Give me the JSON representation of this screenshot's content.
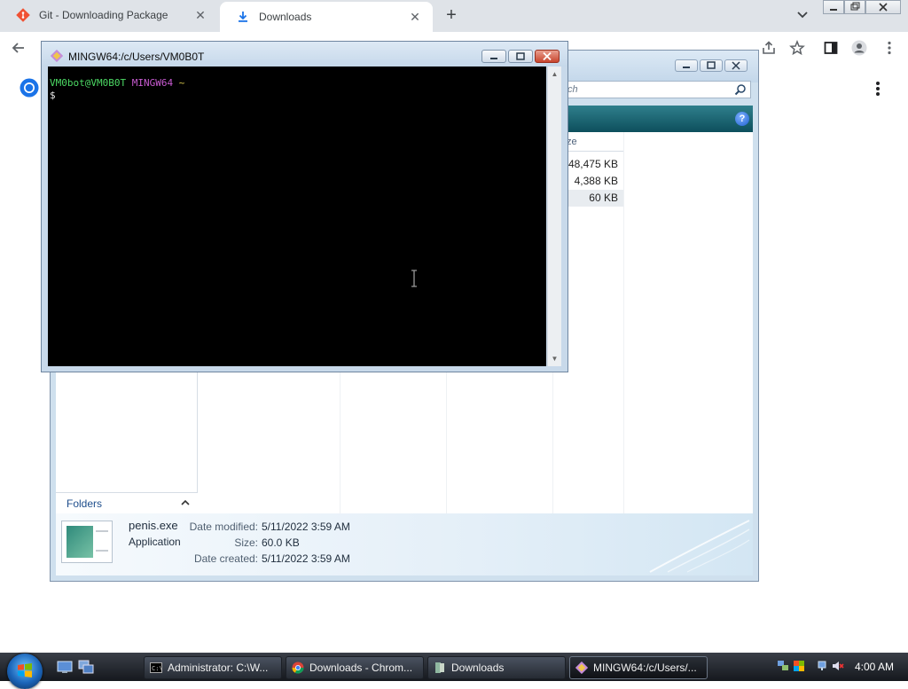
{
  "browser": {
    "tabs": [
      {
        "title": "Git - Downloading Package",
        "icon": "git-icon",
        "active": false
      },
      {
        "title": "Downloads",
        "icon": "download-icon",
        "active": true
      }
    ],
    "new_tab_label": "+",
    "close_glyph": "✕"
  },
  "explorer": {
    "search_placeholder": "ch",
    "size_column_header": "ze",
    "sizes": [
      "48,475 KB",
      "4,388 KB",
      "60 KB"
    ],
    "folders_label": "Folders",
    "help_glyph": "?",
    "details": {
      "file_name": "penis.exe",
      "file_type": "Application",
      "date_modified_label": "Date modified:",
      "date_modified": "5/11/2022 3:59 AM",
      "size_label": "Size:",
      "size": "60.0 KB",
      "date_created_label": "Date created:",
      "date_created": "5/11/2022 3:59 AM"
    }
  },
  "mingw": {
    "title": "MINGW64:/c/Users/VM0B0T",
    "prompt_user": "VM0bot@VM0B0T",
    "prompt_host": "MINGW64",
    "prompt_path": "~",
    "prompt_symbol": "$"
  },
  "taskbar": {
    "buttons": [
      {
        "label": "Administrator: C:\\W...",
        "icon": "cmd-icon",
        "active": false
      },
      {
        "label": "Downloads - Chrom...",
        "icon": "chrome-icon",
        "active": false
      },
      {
        "label": "Downloads",
        "icon": "folder-icon",
        "active": false
      },
      {
        "label": "MINGW64:/c/Users/...",
        "icon": "git-bash-icon",
        "active": true
      }
    ],
    "clock": "4:00 AM"
  },
  "colors": {
    "terminal_bg": "#000000",
    "prompt_user": "#4cd964",
    "prompt_host": "#c85bd1",
    "prompt_path": "#d6c64c",
    "git_brand": "#f05133",
    "chrome_tab_active": "#ffffff",
    "explorer_cmdbar": "#0d4f5c"
  }
}
